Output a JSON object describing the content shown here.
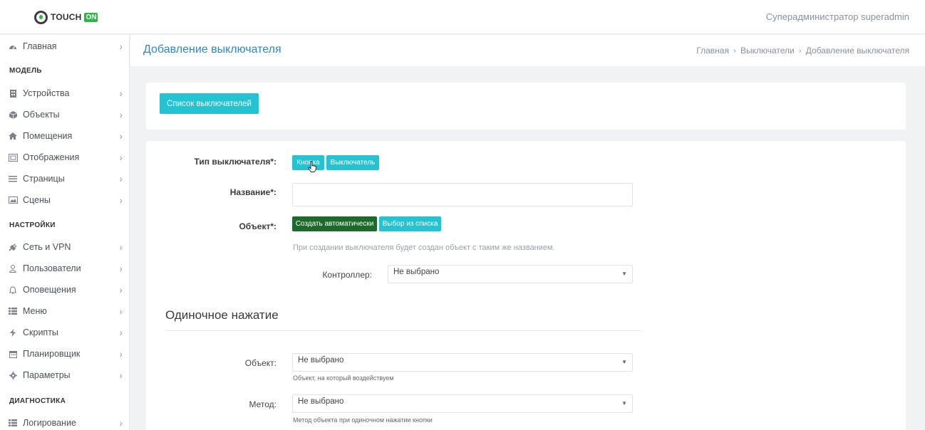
{
  "header": {
    "logo_text": "TOUCH",
    "logo_badge": "ON",
    "user": "Суперадминистратор superadmin"
  },
  "sidebar": {
    "items": [
      {
        "label": "Главная",
        "icon": "dashboard-icon"
      },
      {
        "label": "Устройства",
        "icon": "device-icon"
      },
      {
        "label": "Объекты",
        "icon": "cube-icon"
      },
      {
        "label": "Помещения",
        "icon": "home-icon"
      },
      {
        "label": "Отображения",
        "icon": "display-icon"
      },
      {
        "label": "Страницы",
        "icon": "list-icon"
      },
      {
        "label": "Сцены",
        "icon": "image-icon"
      },
      {
        "label": "Сеть и VPN",
        "icon": "plug-icon"
      },
      {
        "label": "Пользователи",
        "icon": "user-icon"
      },
      {
        "label": "Оповещения",
        "icon": "bell-icon"
      },
      {
        "label": "Меню",
        "icon": "menu-icon"
      },
      {
        "label": "Скрипты",
        "icon": "bolt-icon"
      },
      {
        "label": "Планировщик",
        "icon": "calendar-icon"
      },
      {
        "label": "Параметры",
        "icon": "gear-icon"
      },
      {
        "label": "Логирование",
        "icon": "list-icon"
      }
    ],
    "sections": {
      "model": "МОДЕЛЬ",
      "settings": "НАСТРОЙКИ",
      "diagnostics": "ДИАГНОСТИКА"
    }
  },
  "page": {
    "title": "Добавление выключателя",
    "breadcrumb": [
      "Главная",
      "Выключатели",
      "Добавление выключателя"
    ]
  },
  "toolbar": {
    "list_button": "Список выключателей"
  },
  "form": {
    "type_label": "Тип выключателя*:",
    "type_button_1": "Кнопка",
    "type_button_2": "Выключатель",
    "name_label": "Название*:",
    "name_value": "",
    "object_label": "Объект*:",
    "object_auto": "Создать автоматически",
    "object_list": "Выбор из списка",
    "object_hint": "При создании выключателя будет создан объект с таким же названием.",
    "controller_label": "Контроллер:",
    "controller_value": "Не выбрано",
    "single_press_title": "Одиночное нажатие",
    "sp_object_label": "Объект:",
    "sp_object_value": "Не выбрано",
    "sp_object_hint": "Объект, на который воздействуем",
    "sp_method_label": "Метод:",
    "sp_method_value": "Не выбрано",
    "sp_method_hint": "Метод объекта при одиночном нажатии кнопки"
  },
  "colors": {
    "accent": "#25c2d1",
    "active": "#1d6a2c",
    "title_blue": "#2f86c8",
    "brand_green": "#32b24a"
  }
}
